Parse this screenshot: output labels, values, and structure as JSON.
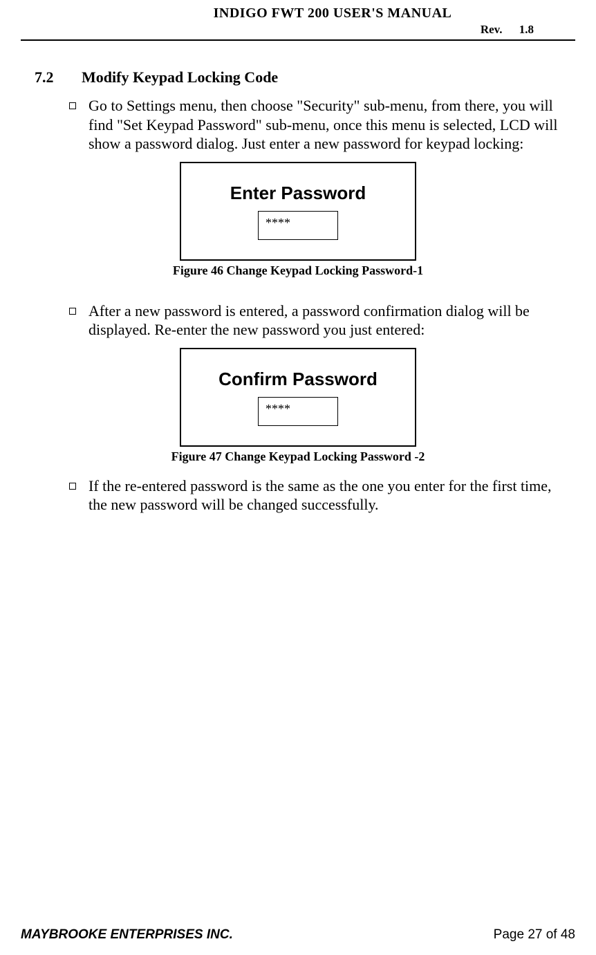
{
  "header": {
    "title": "INDIGO FWT 200 USER'S MANUAL",
    "rev_label": "Rev.",
    "rev_value": "1.8"
  },
  "section": {
    "number": "7.2",
    "title": "Modify Keypad Locking Code"
  },
  "bullets": {
    "item1": "Go to Settings menu, then choose \"Security\" sub-menu, from there, you will find \"Set Keypad Password\" sub-menu, once this menu is selected,  LCD will show a password dialog. Just enter a new password for keypad locking:",
    "item2": "After a new password is entered, a password confirmation dialog will be displayed. Re-enter the new password you just entered:",
    "item3": "If the re-entered password is the same as the one you enter for the first time, the new password will be changed successfully."
  },
  "lcd1": {
    "title": "Enter Password",
    "value": "****"
  },
  "lcd2": {
    "title": "Confirm Password",
    "value": "****"
  },
  "figures": {
    "fig46": "Figure 46  Change Keypad Locking Password-1",
    "fig47": "Figure 47 Change Keypad Locking Password -2"
  },
  "footer": {
    "company": "MAYBROOKE ENTERPRISES INC.",
    "page": "Page 27 of 48"
  }
}
